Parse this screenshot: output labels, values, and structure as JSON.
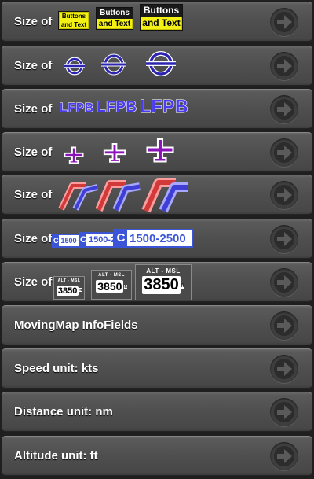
{
  "colors": {
    "row_bg": "#4f4f4f",
    "label_text": "#ffffff",
    "button_yellow": "#f3f015",
    "navaid_blue": "#2d25b0",
    "airport_blue": "#4a3cf0",
    "aircraft_purple": "#8b12b8",
    "freq_blue": "#3b55d6"
  },
  "rows": [
    {
      "label": "Size of",
      "sample_type": "buttons-and-text",
      "samples": [
        {
          "top": "Buttons",
          "bottom": "and Text"
        },
        {
          "top": "Buttons",
          "bottom": "and Text"
        },
        {
          "top": "Buttons",
          "bottom": "and Text"
        }
      ]
    },
    {
      "label": "Size of",
      "sample_type": "navaid-icon"
    },
    {
      "label": "Size of",
      "sample_type": "airport-code",
      "samples": [
        {
          "text": "LFPB"
        },
        {
          "text": "LFPB"
        },
        {
          "text": "LFPB"
        }
      ]
    },
    {
      "label": "Size of",
      "sample_type": "aircraft-icon"
    },
    {
      "label": "Size of",
      "sample_type": "route-line"
    },
    {
      "label": "Size of",
      "sample_type": "frequency-tag",
      "samples": [
        {
          "class": "C",
          "range": "1500-2500"
        },
        {
          "class": "C",
          "range": "1500-2500"
        },
        {
          "class": "C",
          "range": "1500-2500"
        }
      ]
    },
    {
      "label": "Size of",
      "sample_type": "altitude-field",
      "samples": [
        {
          "title": "ALT - MSL",
          "value": "3850",
          "unit": "ft"
        },
        {
          "title": "ALT - MSL",
          "value": "3850",
          "unit": "ft"
        },
        {
          "title": "ALT - MSL",
          "value": "3850",
          "unit": "ft"
        }
      ]
    },
    {
      "label": "MovingMap InfoFields"
    },
    {
      "label": "Speed unit: kts"
    },
    {
      "label": "Distance unit: nm"
    },
    {
      "label": "Altitude unit: ft"
    }
  ],
  "arrow_icon": "arrow-right-circle-icon"
}
